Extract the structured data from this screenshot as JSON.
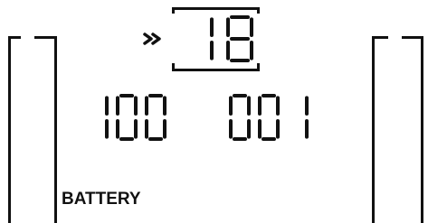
{
  "display": {
    "indicator": "»",
    "top_reading": "18",
    "left_reading": "100",
    "right_reading": "001",
    "battery_label": "BATTERY"
  },
  "colors": {
    "background": "#ffffff",
    "segment": "#111111"
  },
  "icons": {
    "indicator": "double-chevron-right-icon",
    "left_bracket": "left-bracket-frame",
    "right_bracket": "right-bracket-frame",
    "top_frame": "top-reading-frame"
  }
}
